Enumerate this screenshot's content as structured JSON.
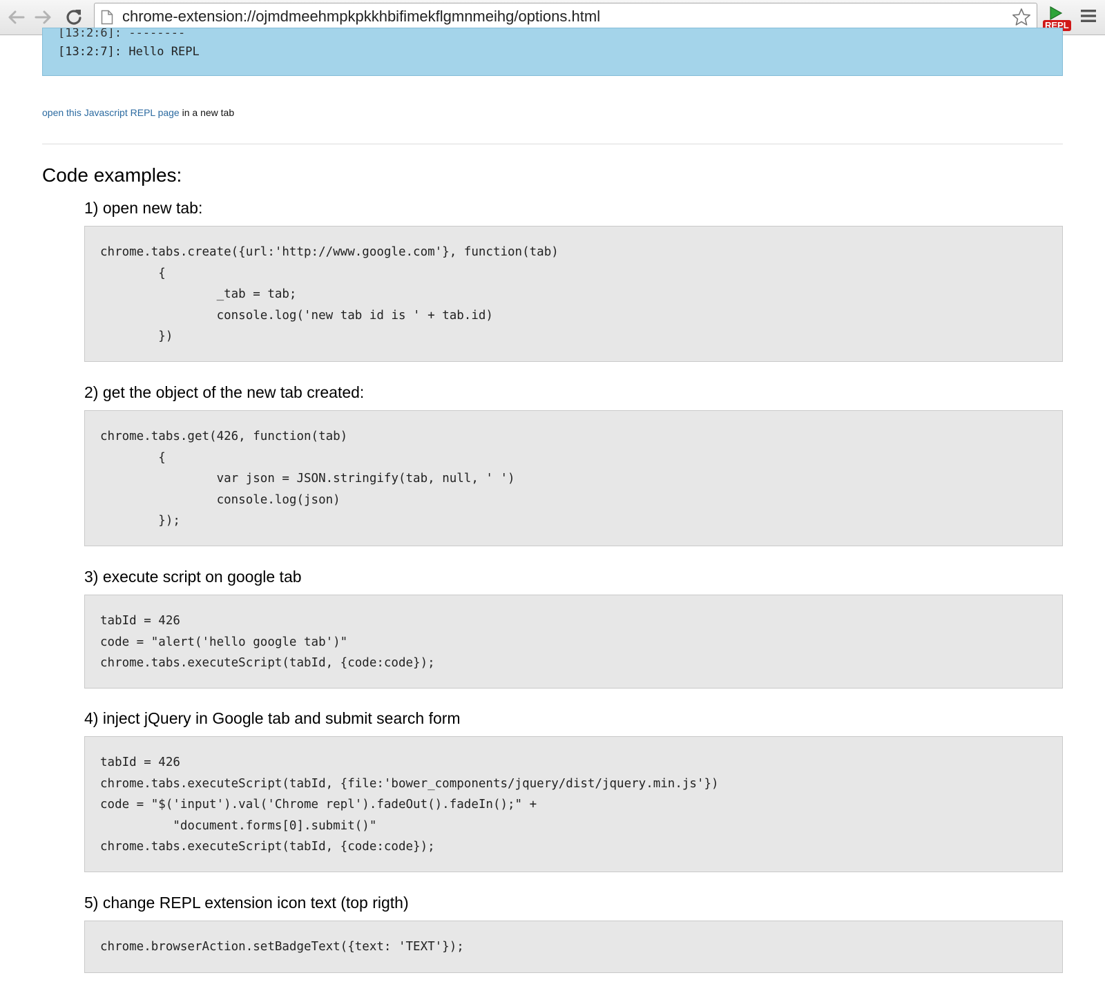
{
  "browser": {
    "url": "chrome-extension://ojmdmeehmpkpkkhbifimekflgmnmeihg/options.html",
    "extension_badge": "REPL"
  },
  "console": {
    "partial_line": "[13:2:6]: --------",
    "last_line": "[13:2:7]: Hello REPL"
  },
  "open_link": {
    "link_text": "open this Javascript REPL page",
    "suffix": " in a new tab"
  },
  "section_heading": "Code examples:",
  "examples": [
    {
      "title": "1) open new tab:",
      "code": "chrome.tabs.create({url:'http://www.google.com'}, function(tab)\n\t{\n\t\t_tab = tab;\n\t\tconsole.log('new tab id is ' + tab.id)\n\t})"
    },
    {
      "title": "2) get the object of the new tab created:",
      "code": "chrome.tabs.get(426, function(tab)\n\t{\n\t\tvar json = JSON.stringify(tab, null, ' ')\n\t\tconsole.log(json)\n\t});"
    },
    {
      "title": "3) execute script on google tab",
      "code": "tabId = 426\ncode = \"alert('hello google tab')\"\nchrome.tabs.executeScript(tabId, {code:code});"
    },
    {
      "title": "4) inject jQuery in Google tab and submit search form",
      "code": "tabId = 426\nchrome.tabs.executeScript(tabId, {file:'bower_components/jquery/dist/jquery.min.js'})\ncode = \"$('input').val('Chrome repl').fadeOut().fadeIn();\" +\n          \"document.forms[0].submit()\"\nchrome.tabs.executeScript(tabId, {code:code});"
    },
    {
      "title": "5) change REPL extension icon text (top rigth)",
      "code": "chrome.browserAction.setBadgeText({text: 'TEXT'});"
    }
  ]
}
